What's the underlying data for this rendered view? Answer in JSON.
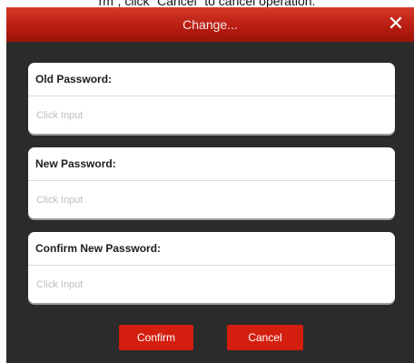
{
  "caption": "rm”, click “Cancel” to cancel operation.",
  "dialog": {
    "title": "Change...",
    "close_glyph": "✕",
    "fields": [
      {
        "label": "Old Password:",
        "placeholder": "Click Input",
        "value": ""
      },
      {
        "label": "New Password:",
        "placeholder": "Click Input",
        "value": ""
      },
      {
        "label": "Confirm New Password:",
        "placeholder": "Click Input",
        "value": ""
      }
    ],
    "confirm_label": "Confirm",
    "cancel_label": "Cancel"
  },
  "colors": {
    "titlebar": "#b91d12",
    "button": "#d41e10",
    "background": "#2b2b2b"
  }
}
